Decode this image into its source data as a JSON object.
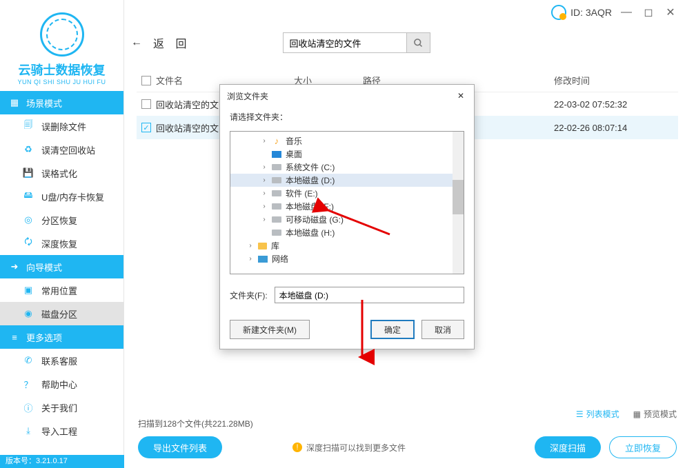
{
  "brand": {
    "title": "云骑士数据恢复",
    "subtitle": "YUN QI SHI SHU JU HUI FU"
  },
  "topbar": {
    "id_label": "ID: 3AQR"
  },
  "nav": {
    "back_label": "返 回",
    "search_value": "回收站清空的文件"
  },
  "sections": {
    "scene": "场景模式",
    "wizard": "向导模式",
    "more": "更多选项"
  },
  "menu": {
    "recycle_delete": "误删除文件",
    "recycle_empty": "误清空回收站",
    "format": "误格式化",
    "usb": "U盘/内存卡恢复",
    "partition": "分区恢复",
    "deep": "深度恢复",
    "common_loc": "常用位置",
    "disk_partition": "磁盘分区",
    "contact": "联系客服",
    "help": "帮助中心",
    "about": "关于我们",
    "import": "导入工程"
  },
  "version": "版本号：3.21.0.17",
  "table": {
    "headers": {
      "name": "文件名",
      "size": "大小",
      "path": "路径",
      "time": "修改时间"
    },
    "rows": [
      {
        "name": "回收站清空的文",
        "time": "22-03-02 07:52:32",
        "checked": false
      },
      {
        "name": "回收站清空的文",
        "time": "22-02-26 08:07:14",
        "checked": true
      }
    ]
  },
  "bottom": {
    "scan_info": "扫描到128个文件(共221.28MB)",
    "export_list": "导出文件列表",
    "tip": "深度扫描可以找到更多文件",
    "deep_scan": "深度扫描",
    "recover_now": "立即恢复",
    "list_mode": "列表模式",
    "preview_mode": "预览模式"
  },
  "dialog": {
    "title": "浏览文件夹",
    "prompt": "请选择文件夹：",
    "folder_label": "文件夹(F):",
    "folder_value": "本地磁盘 (D:)",
    "btn_new": "新建文件夹(M)",
    "btn_ok": "确定",
    "btn_cancel": "取消",
    "tree": {
      "music": "音乐",
      "desktop": "桌面",
      "c": "系统文件 (C:)",
      "d": "本地磁盘 (D:)",
      "e": "软件 (E:)",
      "f": "本地磁盘 (F:)",
      "g": "可移动磁盘 (G:)",
      "h": "本地磁盘 (H:)",
      "lib": "库",
      "net": "网络"
    }
  }
}
